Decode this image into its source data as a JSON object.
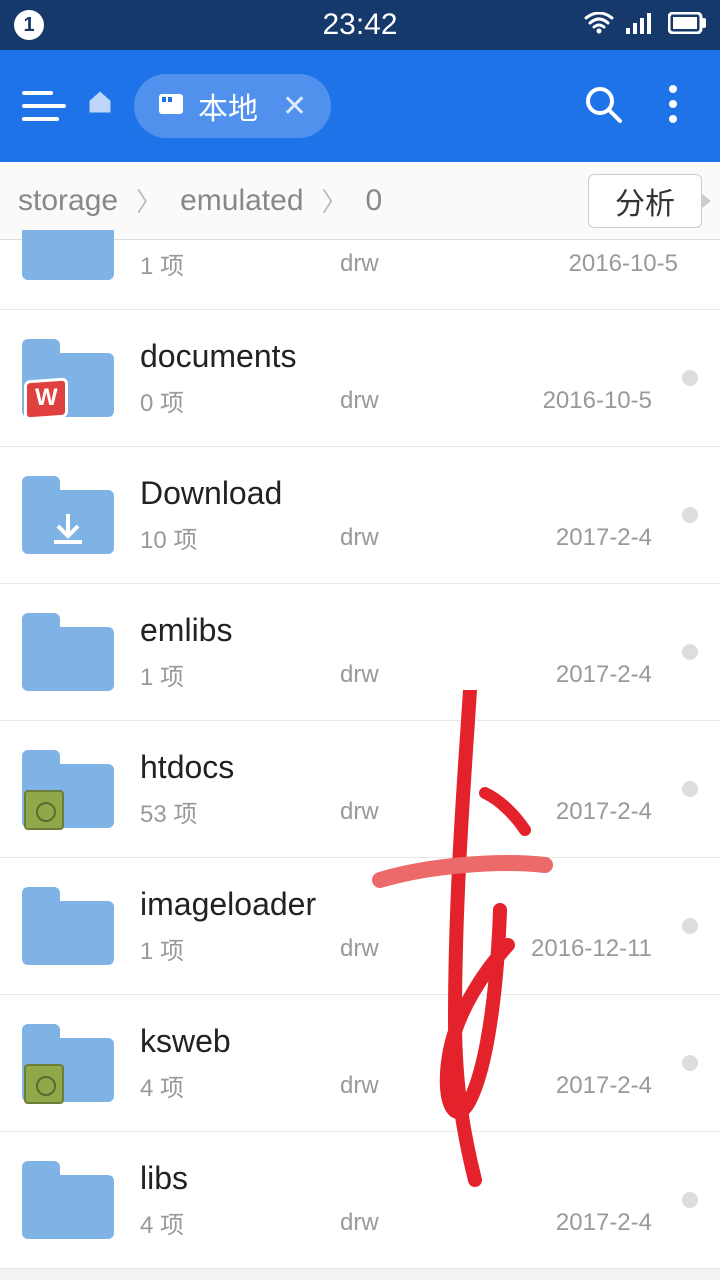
{
  "status": {
    "notif_count": "1",
    "time": "23:42"
  },
  "appbar": {
    "location_label": "本地"
  },
  "breadcrumb": {
    "seg1": "storage",
    "seg2": "emulated",
    "seg3": "0",
    "analyze": "分析"
  },
  "rows": [
    {
      "name": "",
      "count": "1 项",
      "perm": "drw",
      "date": "2016-10-5",
      "icon": "plain",
      "partial": true
    },
    {
      "name": "documents",
      "count": "0 项",
      "perm": "drw",
      "date": "2016-10-5",
      "icon": "wps",
      "partial": false
    },
    {
      "name": "Download",
      "count": "10 项",
      "perm": "drw",
      "date": "2017-2-4",
      "icon": "download",
      "partial": false
    },
    {
      "name": "emlibs",
      "count": "1 项",
      "perm": "drw",
      "date": "2017-2-4",
      "icon": "plain",
      "partial": false
    },
    {
      "name": "htdocs",
      "count": "53 项",
      "perm": "drw",
      "date": "2017-2-4",
      "icon": "green",
      "partial": false
    },
    {
      "name": "imageloader",
      "count": "1 项",
      "perm": "drw",
      "date": "2016-12-11",
      "icon": "plain",
      "partial": false
    },
    {
      "name": "ksweb",
      "count": "4 项",
      "perm": "drw",
      "date": "2017-2-4",
      "icon": "green",
      "partial": false
    },
    {
      "name": "libs",
      "count": "4 项",
      "perm": "drw",
      "date": "2017-2-4",
      "icon": "plain",
      "partial": false
    }
  ]
}
